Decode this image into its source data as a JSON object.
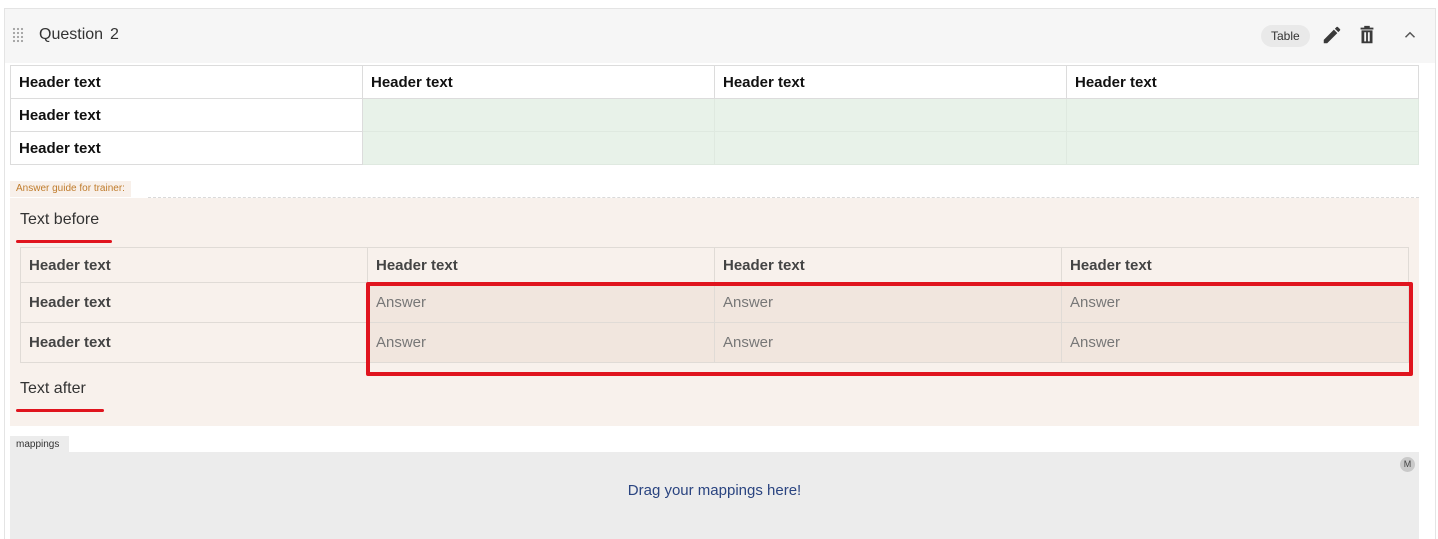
{
  "header": {
    "title": "Question",
    "number": "2",
    "type_chip": "Table",
    "icons": [
      "drag-handle-icon",
      "pencil-icon",
      "trash-icon",
      "chevron-up-icon"
    ]
  },
  "question_table": {
    "header_row": [
      "Header text",
      "Header text",
      "Header text",
      "Header text"
    ],
    "rows": [
      {
        "label": "Header text",
        "cells": [
          "",
          "",
          ""
        ]
      },
      {
        "label": "Header text",
        "cells": [
          "",
          "",
          ""
        ]
      }
    ]
  },
  "answer_guide": {
    "label": "Answer guide for trainer:",
    "text_before": "Text before",
    "text_after": "Text after",
    "table": {
      "header_row": [
        "Header text",
        "Header text",
        "Header text",
        "Header text"
      ],
      "rows": [
        {
          "label": "Header text",
          "cells": [
            "Answer",
            "Answer",
            "Answer"
          ]
        },
        {
          "label": "Header text",
          "cells": [
            "Answer",
            "Answer",
            "Answer"
          ]
        }
      ]
    }
  },
  "mappings": {
    "tab_label": "mappings",
    "badge": "M",
    "drop_text": "Drag your mappings here!"
  },
  "colors": {
    "annotation_red": "#e0141e",
    "answer_cell_bg": "#f1e6de",
    "question_cell_bg": "#e8f2e9",
    "guide_bg": "#f8f1ec",
    "guide_label": "#c07c2c",
    "map_text": "#2a4480"
  }
}
